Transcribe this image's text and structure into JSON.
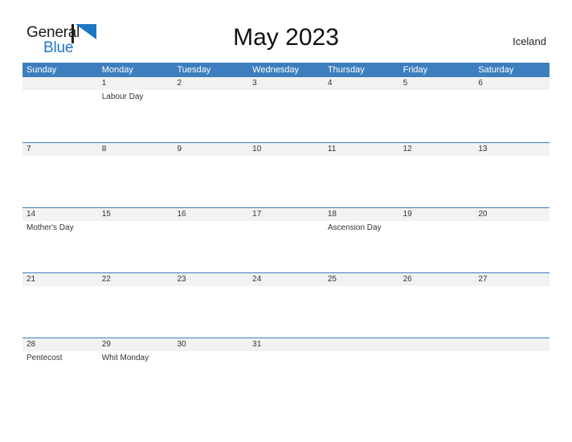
{
  "brand": {
    "name_part1": "General",
    "name_part2": "Blue",
    "flag_icon": "flag-triangle-icon",
    "color_dark": "#1c1c1c",
    "color_blue": "#1f76c4"
  },
  "header": {
    "title": "May 2023",
    "region": "Iceland"
  },
  "calendar": {
    "header_bg": "#3d7ebe",
    "date_strip_bg": "#f2f2f2",
    "rule_color": "#3d7ebe",
    "weekdays": [
      "Sunday",
      "Monday",
      "Tuesday",
      "Wednesday",
      "Thursday",
      "Friday",
      "Saturday"
    ],
    "weeks": [
      {
        "days": [
          {
            "date": "",
            "event": ""
          },
          {
            "date": "1",
            "event": "Labour Day"
          },
          {
            "date": "2",
            "event": ""
          },
          {
            "date": "3",
            "event": ""
          },
          {
            "date": "4",
            "event": ""
          },
          {
            "date": "5",
            "event": ""
          },
          {
            "date": "6",
            "event": ""
          }
        ]
      },
      {
        "days": [
          {
            "date": "7",
            "event": ""
          },
          {
            "date": "8",
            "event": ""
          },
          {
            "date": "9",
            "event": ""
          },
          {
            "date": "10",
            "event": ""
          },
          {
            "date": "11",
            "event": ""
          },
          {
            "date": "12",
            "event": ""
          },
          {
            "date": "13",
            "event": ""
          }
        ]
      },
      {
        "days": [
          {
            "date": "14",
            "event": "Mother's Day"
          },
          {
            "date": "15",
            "event": ""
          },
          {
            "date": "16",
            "event": ""
          },
          {
            "date": "17",
            "event": ""
          },
          {
            "date": "18",
            "event": "Ascension Day"
          },
          {
            "date": "19",
            "event": ""
          },
          {
            "date": "20",
            "event": ""
          }
        ]
      },
      {
        "days": [
          {
            "date": "21",
            "event": ""
          },
          {
            "date": "22",
            "event": ""
          },
          {
            "date": "23",
            "event": ""
          },
          {
            "date": "24",
            "event": ""
          },
          {
            "date": "25",
            "event": ""
          },
          {
            "date": "26",
            "event": ""
          },
          {
            "date": "27",
            "event": ""
          }
        ]
      },
      {
        "days": [
          {
            "date": "28",
            "event": "Pentecost"
          },
          {
            "date": "29",
            "event": "Whit Monday"
          },
          {
            "date": "30",
            "event": ""
          },
          {
            "date": "31",
            "event": ""
          },
          {
            "date": "",
            "event": ""
          },
          {
            "date": "",
            "event": ""
          },
          {
            "date": "",
            "event": ""
          }
        ]
      }
    ]
  }
}
